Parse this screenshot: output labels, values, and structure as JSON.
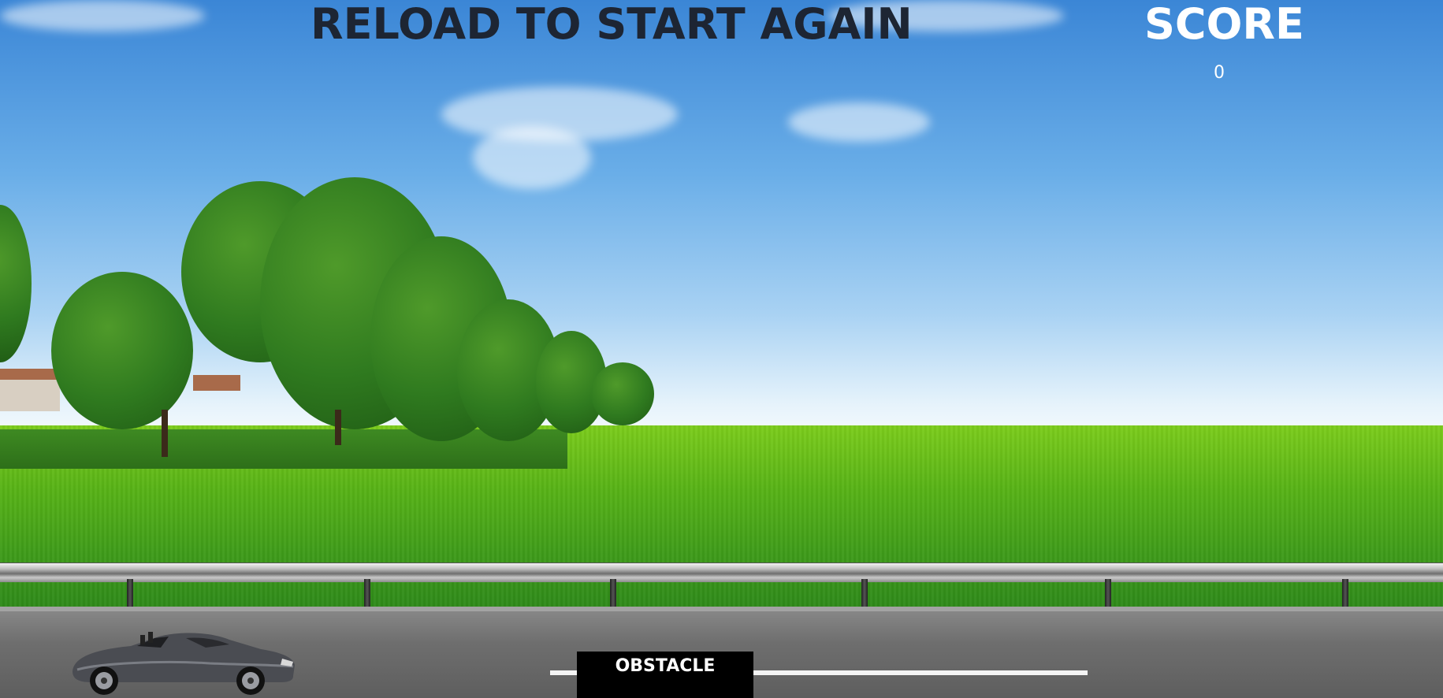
{
  "header": {
    "title": "RELOAD TO START AGAIN",
    "score_label": "SCORE",
    "score_value": "0"
  },
  "game": {
    "obstacle_label": "OBSTACLE",
    "player_icon": "car-icon",
    "scene": "highway-countryside"
  },
  "colors": {
    "title_text": "#1d2533",
    "score_text": "#ffffff",
    "obstacle_bg": "#000000",
    "obstacle_text": "#ffffff"
  }
}
